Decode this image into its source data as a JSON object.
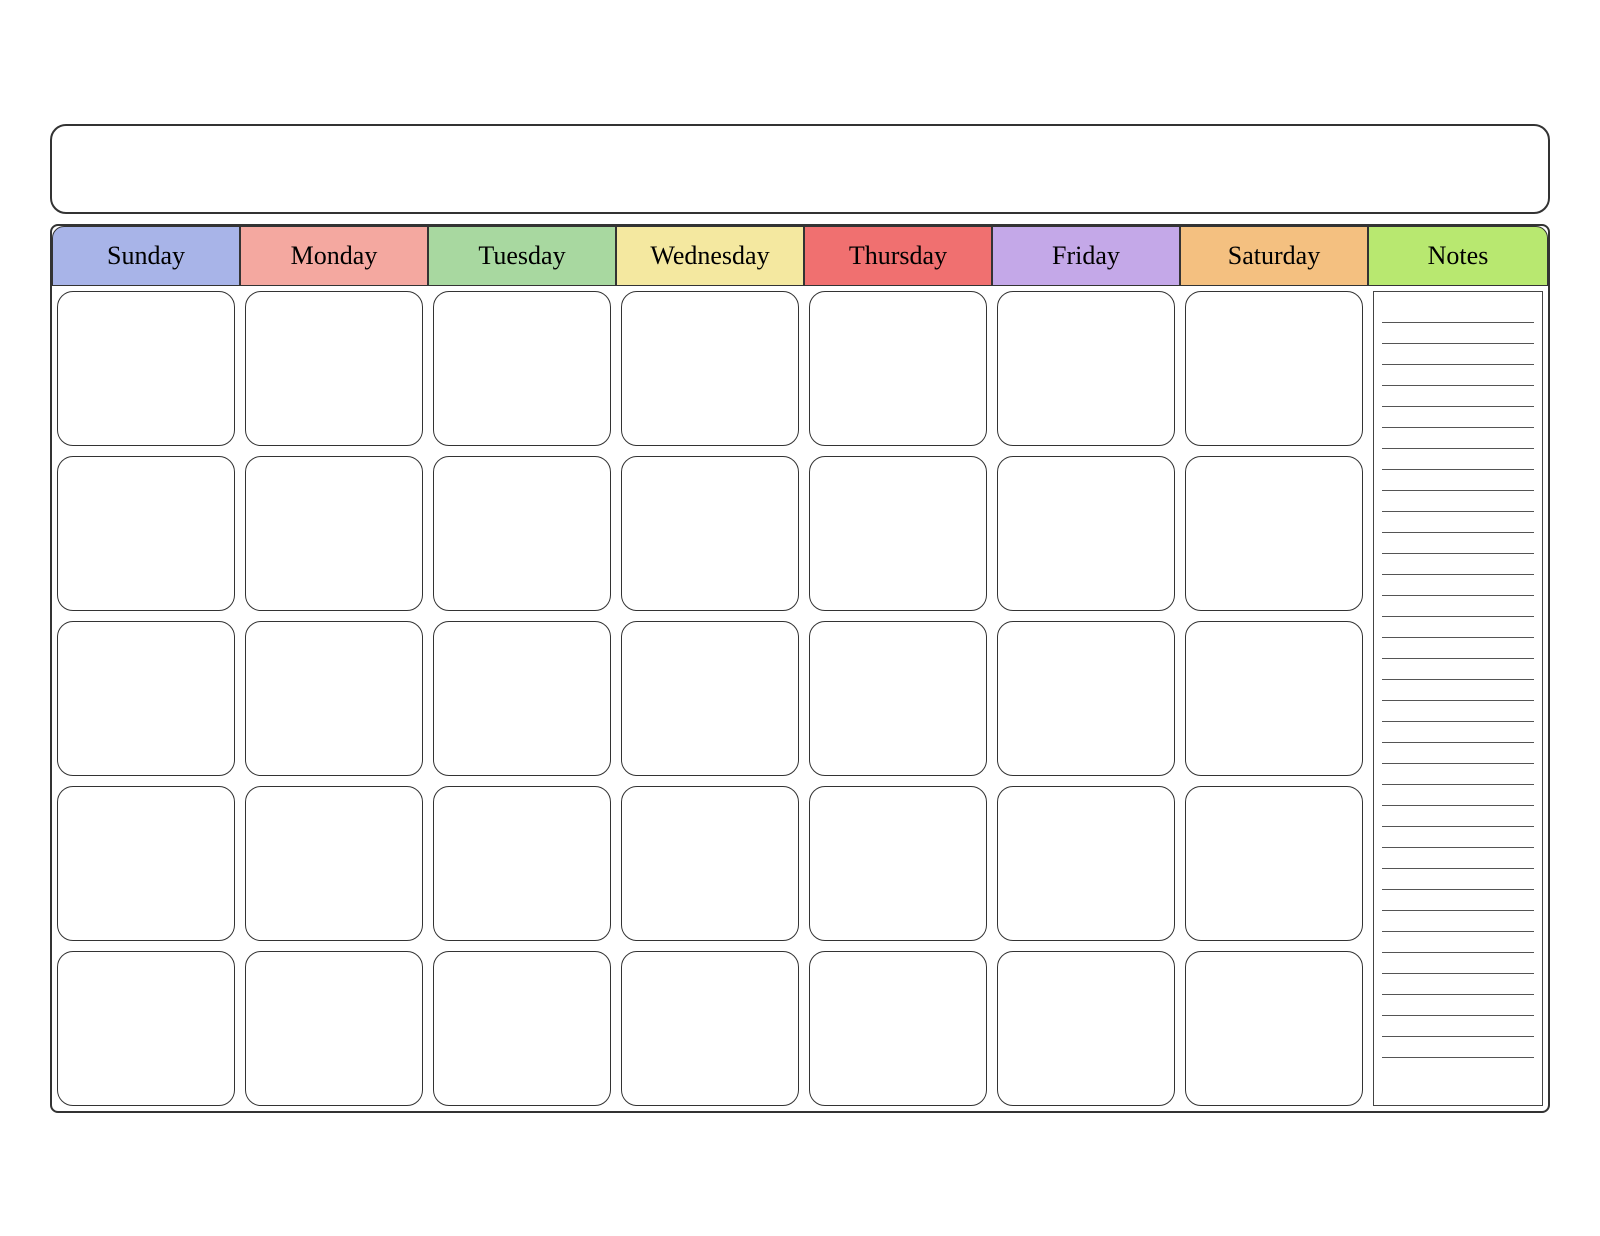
{
  "calendar": {
    "title": "",
    "days": [
      "Sunday",
      "Monday",
      "Tuesday",
      "Wednesday",
      "Thursday",
      "Friday",
      "Saturday"
    ],
    "notes_label": "Notes",
    "header_colors": {
      "Sunday": "#a8b4e8",
      "Monday": "#f4a8a0",
      "Tuesday": "#a8d8a0",
      "Wednesday": "#f4e8a0",
      "Thursday": "#f07070",
      "Friday": "#c4a8e8",
      "Saturday": "#f4c080",
      "Notes": "#b8e870"
    },
    "weeks": 5,
    "notes_lines": 36
  }
}
